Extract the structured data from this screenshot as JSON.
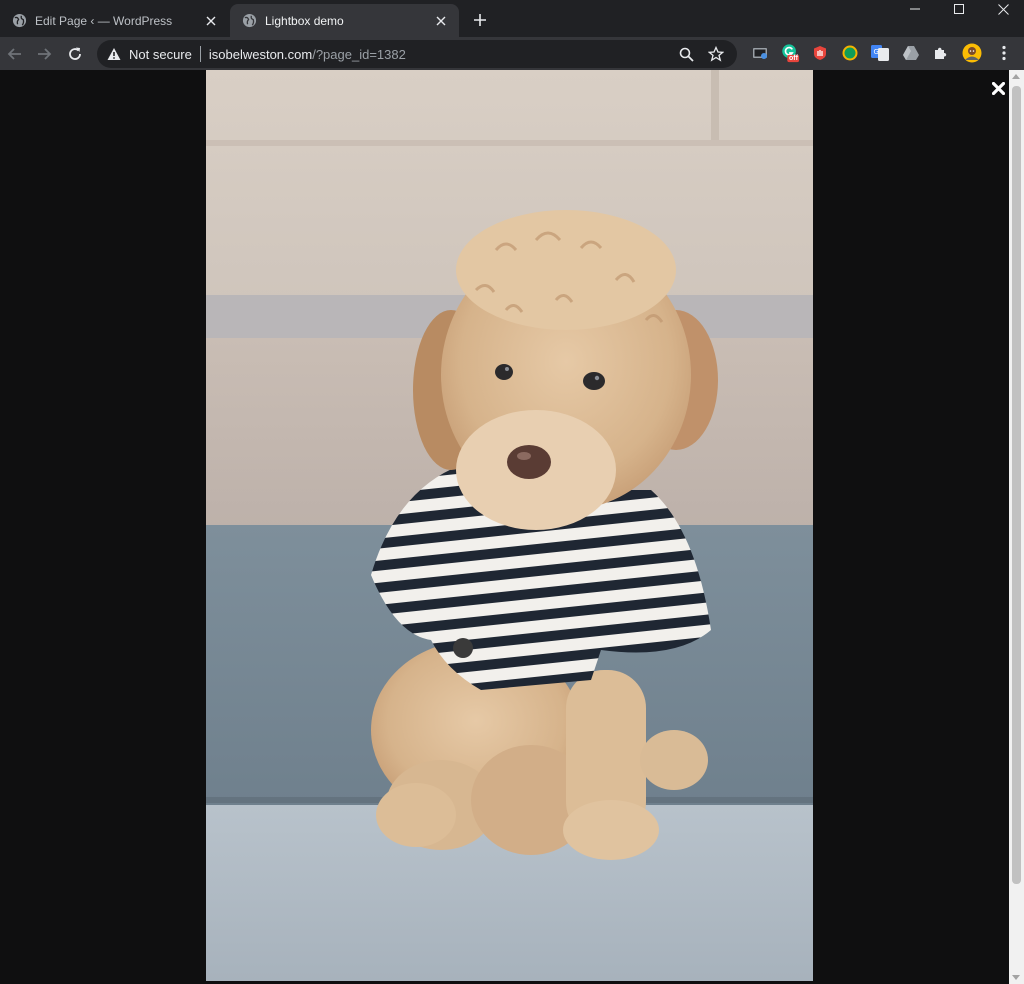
{
  "tabs": [
    {
      "title": "Edit Page ‹ — WordPress",
      "active": false
    },
    {
      "title": "Lightbox demo",
      "active": true
    }
  ],
  "omnibox": {
    "security_label": "Not secure",
    "host": "isobelweston.com",
    "path": "/?page_id=1382"
  },
  "extensions": {
    "grammarly_badge": "off"
  },
  "lightbox": {
    "image_subject": "puppy-in-striped-shirt"
  },
  "colors": {
    "tabstrip_bg": "#202124",
    "toolbar_bg": "#35363a",
    "overlay_bg": "#0f0f10"
  }
}
